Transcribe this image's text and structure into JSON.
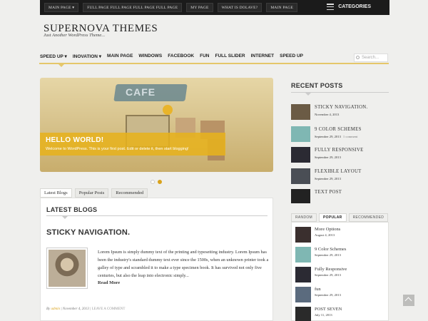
{
  "topbar": {
    "nav": [
      "MAIN PAGE ▾",
      "FULL PAGE FULL PAGE FULL PAGE FULL PAGE",
      "MY PAGE",
      "WHAT IS DOLAVE?",
      "MAIN PAGE"
    ],
    "categories_label": "CATEGORIES"
  },
  "header": {
    "title": "SUPERNOVA THEMES",
    "tagline": "Just Another WordPress Theme..."
  },
  "mainnav": [
    "SPEED UP ▾",
    "INOVATION ▾",
    "MAIN PAGE",
    "WINDOWS",
    "FACEBOOK",
    "FUN",
    "FULL SLIDER",
    "INTERNET",
    "SPEED UP"
  ],
  "search": {
    "placeholder": "Search..."
  },
  "slider": {
    "sign_text": "CAFE",
    "caption_title": "HELLO WORLD!",
    "caption_text": "Welcome to WordPress. This is your first post. Edit or delete it, then start blogging!",
    "active_slide": 2,
    "slide_count": 2
  },
  "tabs": [
    "Latest Blogs",
    "Popular Posts",
    "Recommended"
  ],
  "latest": {
    "heading": "LATEST BLOGS",
    "post_title": "STICKY NAVIGATION.",
    "excerpt": "Lorem Ipsum is simply dummy text of the printing and typesetting industry. Lorem Ipsum has been the industry's standard dummy text ever since the 1500s, when an unknown printer took a galley of type and scrambled it to make a type specimen book. It has survived not only five centuries, but also the leap into electronic simply...",
    "read_more": "Read More",
    "meta_by": "By",
    "meta_author": "admin",
    "meta_date": "| November 4, 2013 |",
    "meta_comment": "LEAVE A COMMENT"
  },
  "recent": {
    "heading": "RECENT POSTS",
    "items": [
      {
        "title": "STICKY NAVIGATION.",
        "date": "November 4, 2013",
        "comments": "",
        "color": "#6b5b45"
      },
      {
        "title": "9 COLOR SCHEMES",
        "date": "September 29, 2013",
        "comments": "1 comment",
        "color": "#7fb7b3"
      },
      {
        "title": "FULLY RESPONSIVE",
        "date": "September 29, 2013",
        "comments": "",
        "color": "#2b2a33"
      },
      {
        "title": "FLEXIBLE LAYOUT",
        "date": "September 29, 2013",
        "comments": "",
        "color": "#4a4e55"
      },
      {
        "title": "TEXT POST",
        "date": "",
        "comments": "",
        "color": "#222222"
      }
    ]
  },
  "widget": {
    "tabs": [
      "RANDOM",
      "POPULAR",
      "RECOMMENDED"
    ],
    "items": [
      {
        "title": "More Options",
        "date": "August 4, 2013",
        "color": "#3a2f2e"
      },
      {
        "title": "9 Color Schemes",
        "date": "September 29, 2013",
        "color": "#7fb7b3"
      },
      {
        "title": "Fully Responsive",
        "date": "September 29, 2013",
        "color": "#2b2a33"
      },
      {
        "title": "fun",
        "date": "September 29, 2013",
        "color": "#5b6b7e"
      },
      {
        "title": "POST SEVEN",
        "date": "July 11, 2013",
        "color": "#2a2a2a"
      }
    ]
  },
  "colors": {
    "accent": "#e5c76a",
    "caption": "#e6b21e",
    "topbar": "#1b1b1b"
  }
}
